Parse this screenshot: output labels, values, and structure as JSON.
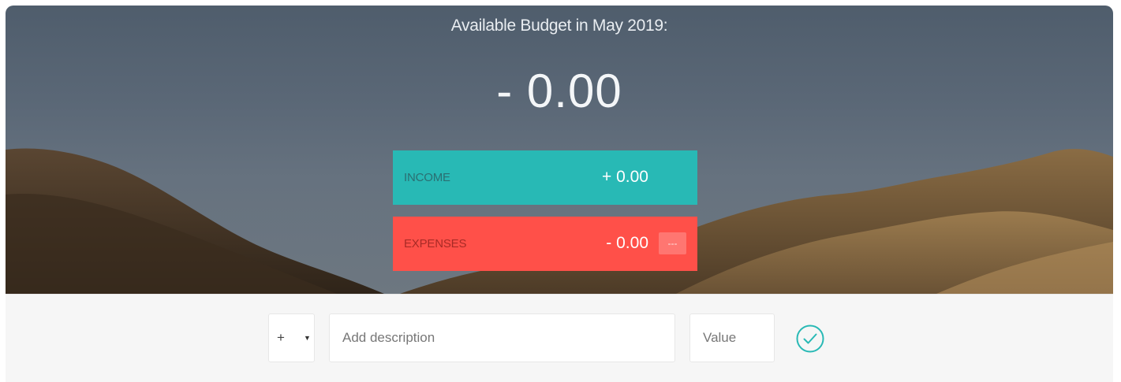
{
  "budget": {
    "title": "Available Budget in May 2019:",
    "value": "- 0.00"
  },
  "income": {
    "label": "INCOME",
    "value": "+ 0.00",
    "color": "#28b9b5"
  },
  "expenses": {
    "label": "EXPENSES",
    "value": "- 0.00",
    "percentage": "---",
    "color": "#ff5049"
  },
  "add_form": {
    "type_value": "+",
    "description_placeholder": "Add description",
    "value_placeholder": "Value",
    "submit_icon": "check-circle-icon",
    "accent": "#28b9b5"
  }
}
